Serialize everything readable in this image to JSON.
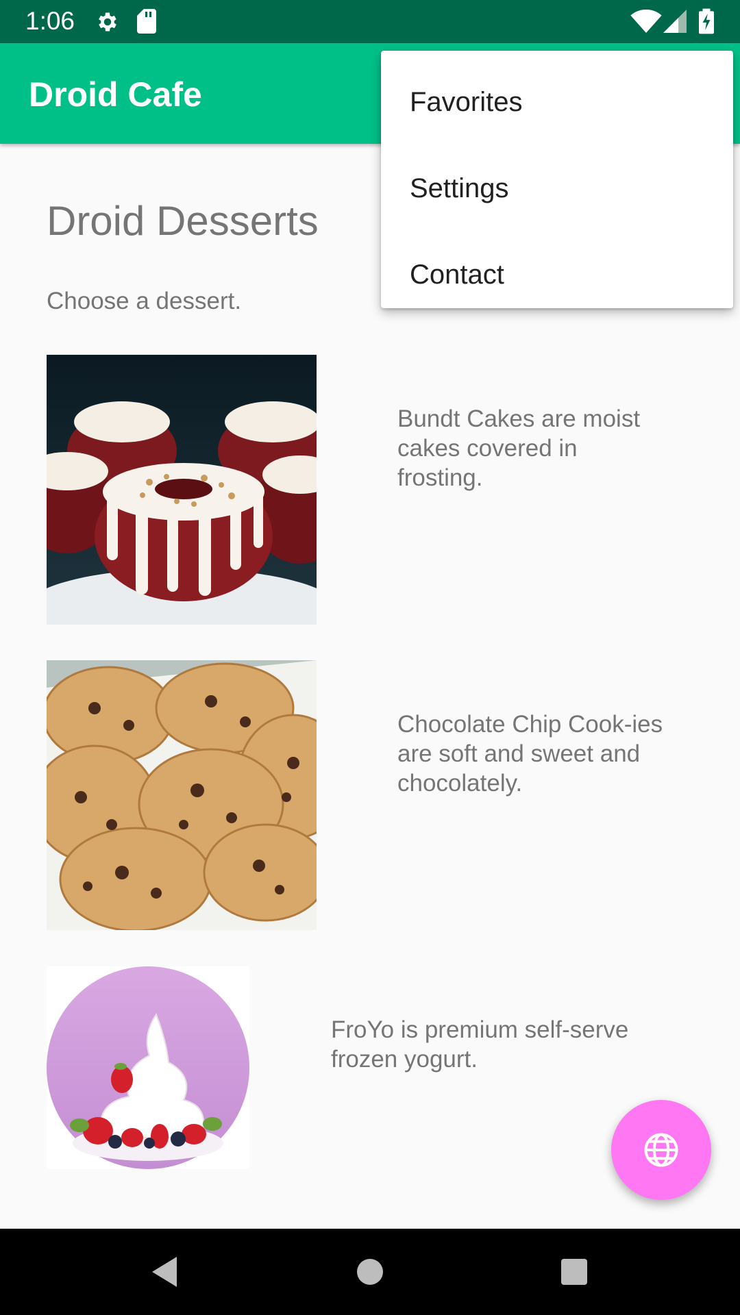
{
  "status_bar": {
    "time": "1:06",
    "icons": [
      "settings-gear-icon",
      "sd-card-icon",
      "wifi-icon",
      "cell-signal-icon",
      "battery-charging-icon"
    ],
    "background": "#00684a"
  },
  "app_bar": {
    "title": "Droid Cafe",
    "background": "#00c088"
  },
  "content": {
    "title": "Droid Desserts",
    "subtitle": "Choose a dessert.",
    "desserts": [
      {
        "image": "bundt-cakes-image",
        "description": "Bundt Cakes are moist cakes covered in frosting."
      },
      {
        "image": "chocolate-chip-cookies-image",
        "description": "Chocolate Chip Cook-ies are soft and sweet and chocolately."
      },
      {
        "image": "froyo-image",
        "description": "FroYo is premium self-serve frozen yogurt."
      }
    ]
  },
  "overflow_menu": {
    "items": [
      {
        "label": "Favorites"
      },
      {
        "label": "Settings"
      },
      {
        "label": "Contact"
      }
    ]
  },
  "fab": {
    "icon": "globe-icon",
    "color": "#ff77f2"
  },
  "nav_bar": {
    "buttons": [
      "back-icon",
      "home-icon",
      "recents-icon"
    ]
  }
}
